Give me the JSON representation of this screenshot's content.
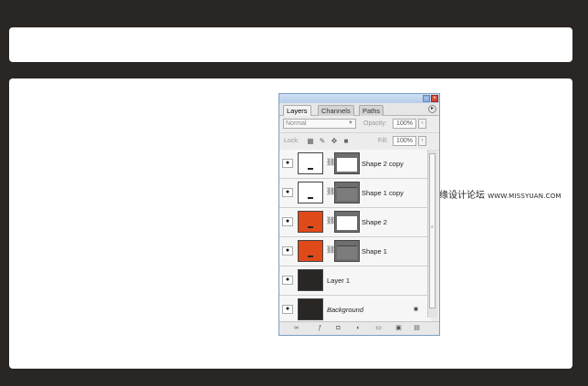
{
  "watermark": {
    "cn": "思缘设计论坛",
    "url": "WWW.MISSYUAN.COM"
  },
  "palette": {
    "tabs": [
      "Layers",
      "Channels",
      "Paths"
    ],
    "blend_mode": "Normal",
    "opacity_label": "Opacity:",
    "opacity_value": "100%",
    "lock_label": "Lock:",
    "fill_label": "Fill:",
    "fill_value": "100%",
    "layers": [
      {
        "name": "Shape 2 copy"
      },
      {
        "name": "Shape 1 copy"
      },
      {
        "name": "Shape 2"
      },
      {
        "name": "Shape 1"
      },
      {
        "name": "Layer 1"
      },
      {
        "name": "Background"
      }
    ],
    "colors": {
      "orange": "#e04a1a",
      "dark": "#2a2624"
    }
  }
}
